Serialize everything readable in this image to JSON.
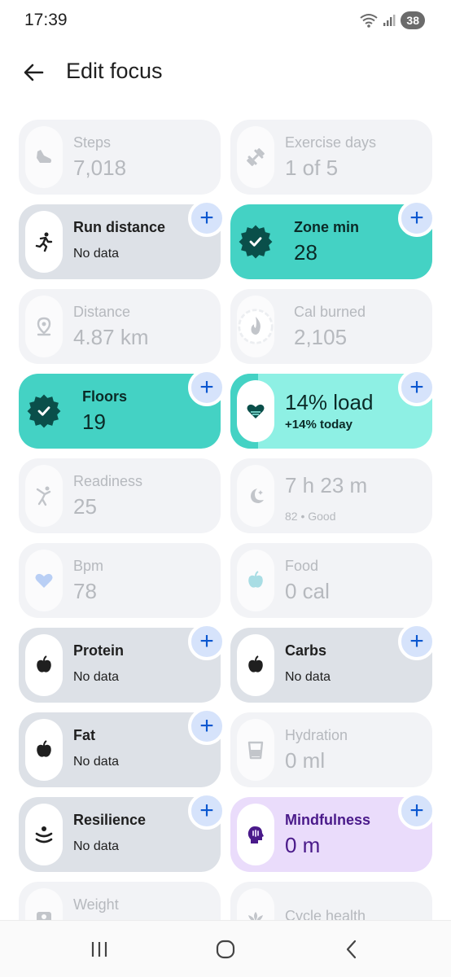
{
  "status_bar": {
    "time": "17:39",
    "battery": "38"
  },
  "header": {
    "title": "Edit focus"
  },
  "tiles": [
    {
      "label": "Steps",
      "value": "7,018",
      "icon": "shoe-icon",
      "state": "disabled"
    },
    {
      "label": "Exercise days",
      "value": "1 of 5",
      "icon": "dumbbell-icon",
      "state": "disabled"
    },
    {
      "label": "Run distance",
      "sub": "No data",
      "icon": "running-person-icon",
      "state": "available"
    },
    {
      "label": "Zone min",
      "value": "28",
      "icon": "badge-check-icon",
      "state": "selected"
    },
    {
      "label": "Distance",
      "value": "4.87 km",
      "icon": "location-pin-icon",
      "state": "disabled"
    },
    {
      "label": "Cal burned",
      "value": "2,105",
      "icon": "flame-icon",
      "state": "disabled"
    },
    {
      "label": "Floors",
      "value": "19",
      "icon": "badge-check-icon",
      "state": "selected"
    },
    {
      "value": "14% load",
      "sub": "+14% today",
      "icon": "heart-waves-icon",
      "state": "selected"
    },
    {
      "label": "Readiness",
      "value": "25",
      "icon": "stretching-person-icon",
      "state": "disabled"
    },
    {
      "value": "7 h 23 m",
      "sub": "82 • Good",
      "icon": "moon-star-icon",
      "state": "disabled"
    },
    {
      "label": "Bpm",
      "value": "78",
      "icon": "heart-icon",
      "state": "disabled"
    },
    {
      "label": "Food",
      "value": "0 cal",
      "icon": "apple-icon",
      "state": "disabled"
    },
    {
      "label": "Protein",
      "sub": "No data",
      "icon": "apple-icon",
      "state": "available"
    },
    {
      "label": "Carbs",
      "sub": "No data",
      "icon": "apple-icon",
      "state": "available"
    },
    {
      "label": "Fat",
      "sub": "No data",
      "icon": "apple-icon",
      "state": "available"
    },
    {
      "label": "Hydration",
      "value": "0 ml",
      "icon": "water-glass-icon",
      "state": "disabled"
    },
    {
      "label": "Resilience",
      "sub": "No data",
      "icon": "resilience-icon",
      "state": "available"
    },
    {
      "label": "Mindfulness",
      "value": "0 m",
      "icon": "mind-head-icon",
      "state": "selected"
    },
    {
      "label": "Weight",
      "icon": "scale-icon",
      "state": "disabled"
    },
    {
      "label": "Cycle health",
      "icon": "lotus-icon",
      "state": "disabled"
    }
  ],
  "colors": {
    "accent": "#0b57d0",
    "teal": "#44d2c4",
    "mint": "#8ef0e4",
    "purple_bg": "#eadcfb",
    "add_bg": "#d6e3fb"
  }
}
